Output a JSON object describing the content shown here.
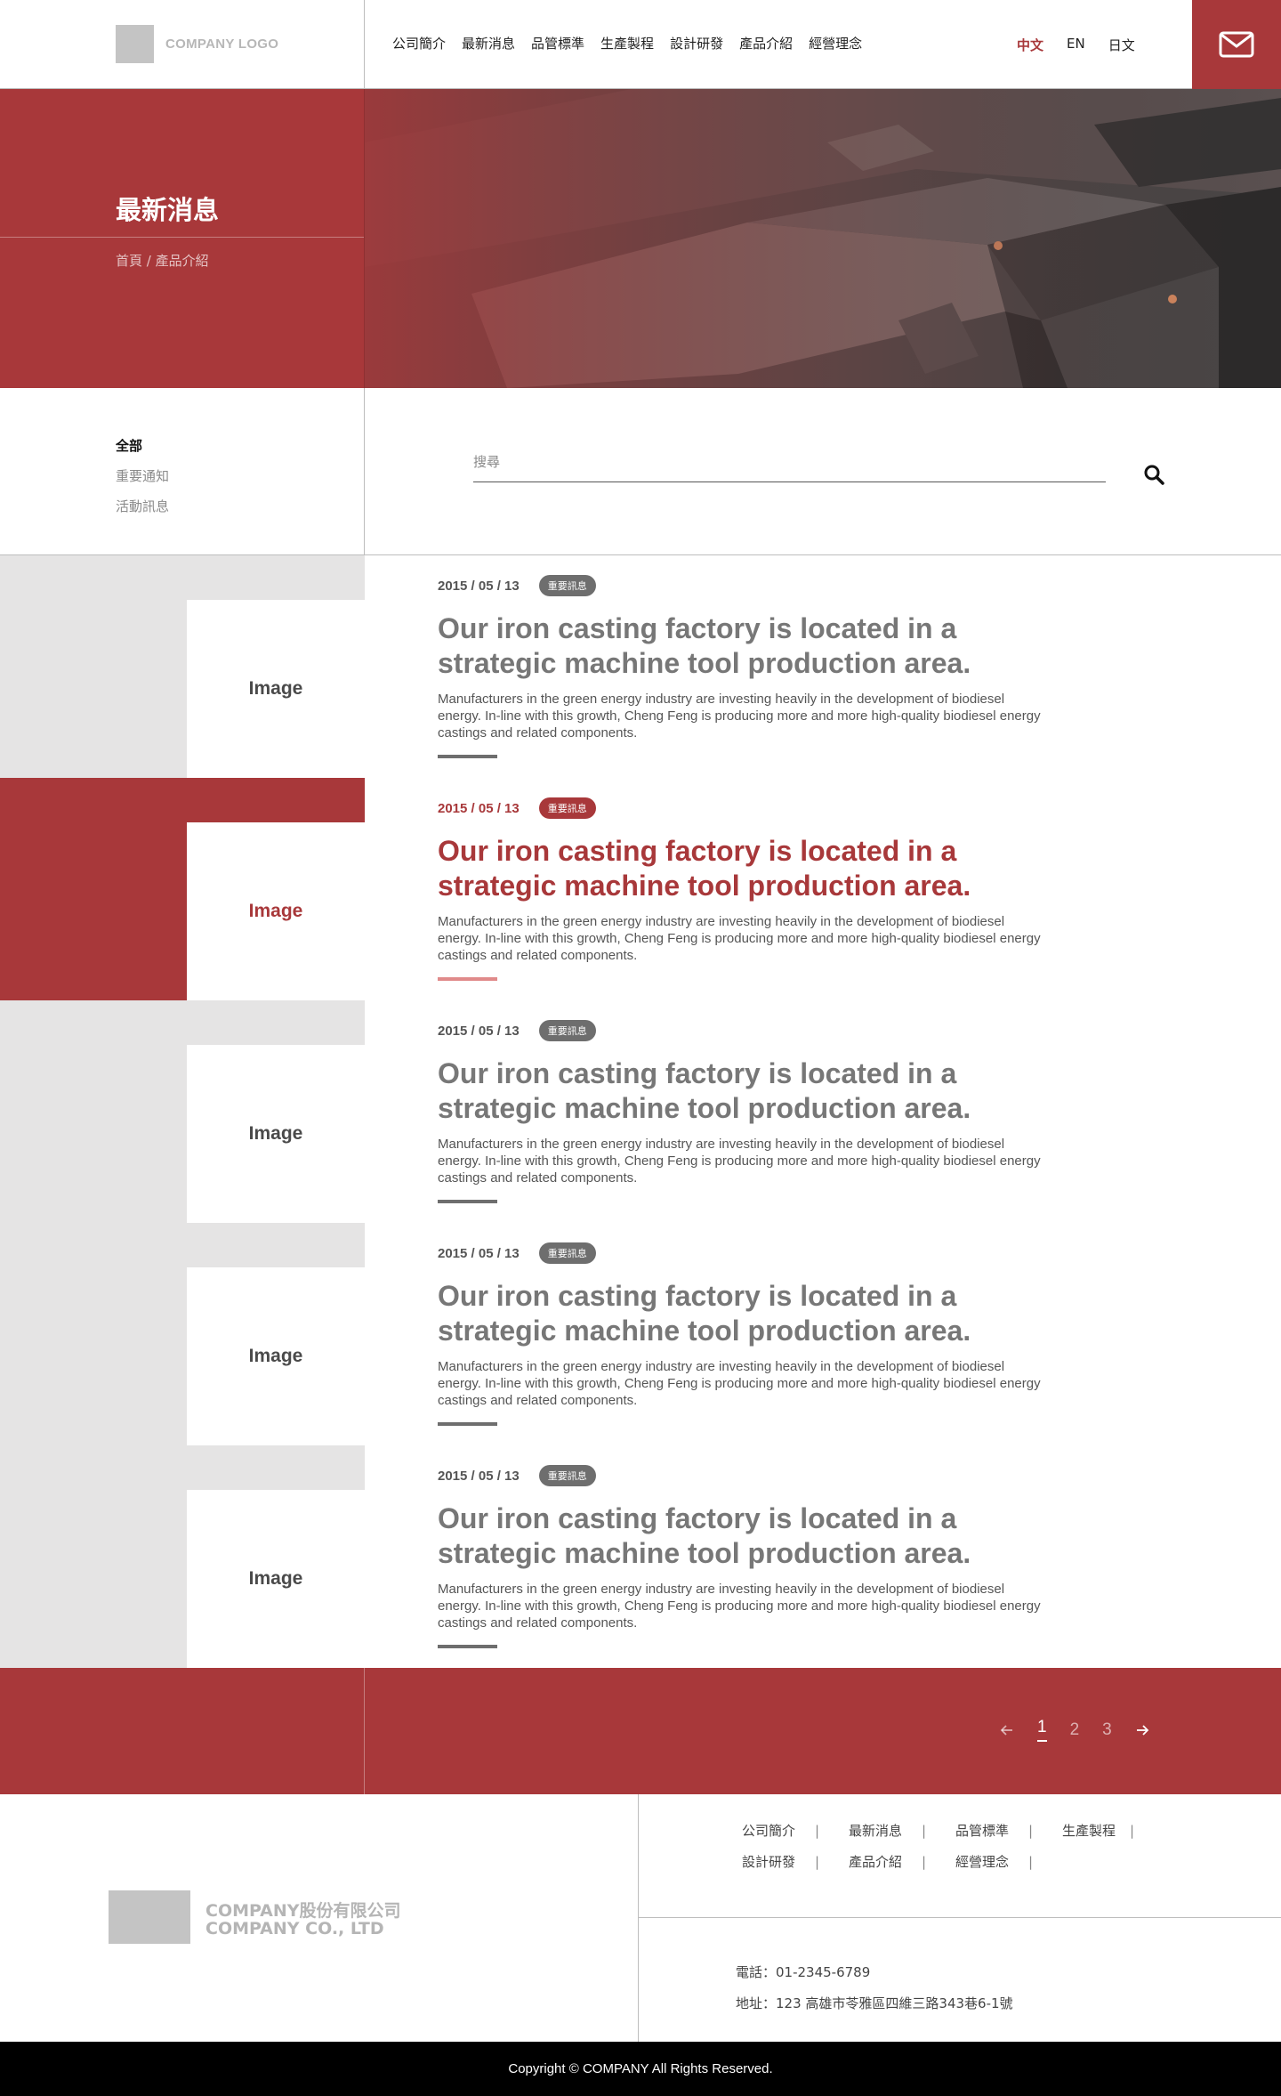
{
  "header": {
    "logo_text": "COMPANY LOGO",
    "nav": [
      "公司簡介",
      "最新消息",
      "品管標準",
      "生產製程",
      "設計研發",
      "產品介紹",
      "經營理念"
    ],
    "languages": [
      "中文",
      "EN",
      "日文"
    ],
    "active_language": "中文",
    "mail_icon": "envelope-icon"
  },
  "hero": {
    "title": "最新消息",
    "breadcrumb": "首頁 / 產品介紹"
  },
  "filter": {
    "categories": [
      "全部",
      "重要通知",
      "活動訊息"
    ],
    "active_category": "全部",
    "search_placeholder": "搜尋",
    "search_icon": "search-icon"
  },
  "news": {
    "items": [
      {
        "image_label": "Image",
        "date": "2015 / 05 / 13",
        "tag": "重要訊息",
        "title": "Our iron casting factory is located in a strategic machine tool production area.",
        "desc": "Manufacturers in the green energy industry are investing heavily in the development of biodiesel energy. In-line with this growth, Cheng Feng is producing more and more high-quality biodiesel energy castings and related components.",
        "active": false
      },
      {
        "image_label": "Image",
        "date": "2015 / 05 / 13",
        "tag": "重要訊息",
        "title": "Our iron casting factory is located in a strategic machine tool production area.",
        "desc": "Manufacturers in the green energy industry are investing heavily in the development of biodiesel energy. In-line with this growth, Cheng Feng is producing more and more high-quality biodiesel energy castings and related components.",
        "active": true
      },
      {
        "image_label": "Image",
        "date": "2015 / 05 / 13",
        "tag": "重要訊息",
        "title": "Our iron casting factory is located in a strategic machine tool production area.",
        "desc": "Manufacturers in the green energy industry are investing heavily in the development of biodiesel energy. In-line with this growth, Cheng Feng is producing more and more high-quality biodiesel energy castings and related components.",
        "active": false
      },
      {
        "image_label": "Image",
        "date": "2015 / 05 / 13",
        "tag": "重要訊息",
        "title": "Our iron casting factory is located in a strategic machine tool production area.",
        "desc": "Manufacturers in the green energy industry are investing heavily in the development of biodiesel energy. In-line with this growth, Cheng Feng is producing more and more high-quality biodiesel energy castings and related components.",
        "active": false
      },
      {
        "image_label": "Image",
        "date": "2015 / 05 / 13",
        "tag": "重要訊息",
        "title": "Our iron casting factory is located in a strategic machine tool production area.",
        "desc": "Manufacturers in the green energy industry are investing heavily in the development of biodiesel energy. In-line with this growth, Cheng Feng is producing more and more high-quality biodiesel energy castings and related components.",
        "active": false
      }
    ]
  },
  "pagination": {
    "pages": [
      "1",
      "2",
      "3"
    ],
    "current": "1",
    "prev_icon": "arrow-left-icon",
    "next_icon": "arrow-right-icon"
  },
  "footer": {
    "company_name_zh": "COMPANY股份有限公司",
    "company_name_en": "COMPANY CO., LTD",
    "links": [
      "公司簡介",
      "最新消息",
      "品管標準",
      "生產製程",
      "設計研發",
      "產品介紹",
      "經營理念"
    ],
    "tel": "電話：01-2345-6789",
    "address": "地址：123 高雄市苓雅區四維三路343巷6-1號",
    "copyright": "Copyright © COMPANY All Rights Reserved."
  },
  "colors": {
    "brand_red": "#a8383a",
    "gray_block": "#e5e4e4",
    "tag_gray": "#6e6e6e"
  }
}
